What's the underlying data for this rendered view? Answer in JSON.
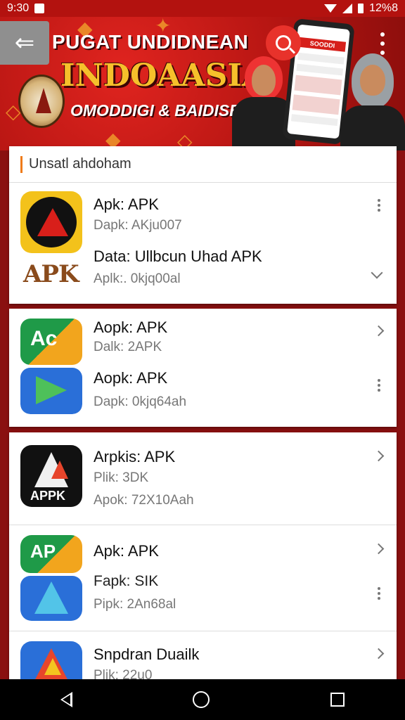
{
  "status_bar": {
    "time": "9:30",
    "battery": "12%8"
  },
  "banner": {
    "title_line1": "PUGAT UNDIDNEAN",
    "title_line2": "INDOAASIA",
    "title_line3": "OMODDIGI & BAIDISE!",
    "phone_screen_title": "SOODDI"
  },
  "list": {
    "section_header": "Unsatl ahdoham",
    "cards": [
      {
        "rows": [
          {
            "title": "Apk: APK",
            "subtitle": "Dapk: AKju007",
            "title2": "Data: Ullbcun Uhad APK",
            "subtitle2": "Aplk:. 0kjq00al",
            "icon": "apk-logo-icon",
            "icon_label": "APK"
          }
        ]
      },
      {
        "rows": [
          {
            "title": "Aopk: APK",
            "subtitle": "Dalk: 2APK",
            "title2": "Aopk: APK",
            "subtitle2": "Dapk: 0kjq64ah",
            "icon": "apk-combo-icon",
            "icon_label": "Ac"
          }
        ]
      },
      {
        "rows": [
          {
            "title": "Arpkis: APK",
            "subtitle": "Plik: 3DK",
            "subtitle2": "Apok: 72X10Aah",
            "icon": "appk-icon",
            "icon_label": "APPK"
          },
          {
            "title": "Apk: APK",
            "subtitle": "Fapk: SIK",
            "subtitle2": "Pipk: 2An68al",
            "icon": "ap-icon",
            "icon_label": "AP"
          },
          {
            "title": "Snpdran Duailk",
            "subtitle": "Plik: 22u0",
            "icon": "gem-icon"
          }
        ]
      }
    ]
  },
  "colors": {
    "banner_red": "#b51512",
    "accent_orange": "#ef7b1a",
    "gold": "#f6c02b"
  }
}
